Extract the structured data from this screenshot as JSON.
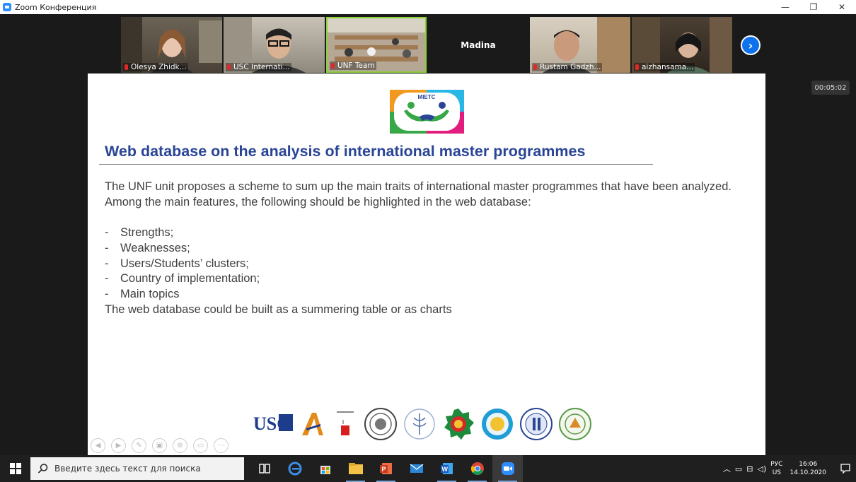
{
  "window": {
    "title": "Zoom Конференция",
    "minimize": "—",
    "restore": "❐",
    "close": "✕"
  },
  "participants": [
    {
      "name": "Olesya Zhidk..."
    },
    {
      "name": "USC Internati..."
    },
    {
      "name": "UNF Team"
    },
    {
      "name": "Madina"
    },
    {
      "name": "Rustam Gadzh..."
    },
    {
      "name": "aizhansama..."
    }
  ],
  "next_page_glyph": "›",
  "timer": "00:05:02",
  "slide": {
    "logo_text": "MIETC",
    "title": "Web database on the analysis of international master programmes",
    "intro_1": "The UNF unit proposes a scheme to sum up the main traits of international master programmes that have been analyzed.",
    "intro_2": "Among the main features, the following should be highlighted in the web database:",
    "bullets": [
      "Strengths;",
      "Weaknesses;",
      "Users/Students’ clusters;",
      "Country of implementation;",
      "Main topics"
    ],
    "bullet_mark": "-",
    "closing": "The web database could be built as a summering table or as charts",
    "partner_usc": "USC"
  },
  "colors": {
    "title_blue": "#2a4595",
    "zoom_blue": "#0e72ed",
    "body_gray": "#404040"
  },
  "taskbar": {
    "search_placeholder": "Введите здесь текст для поиска",
    "lang_top": "РУС",
    "lang_bottom": "US",
    "time": "16:06",
    "date": "14.10.2020"
  }
}
